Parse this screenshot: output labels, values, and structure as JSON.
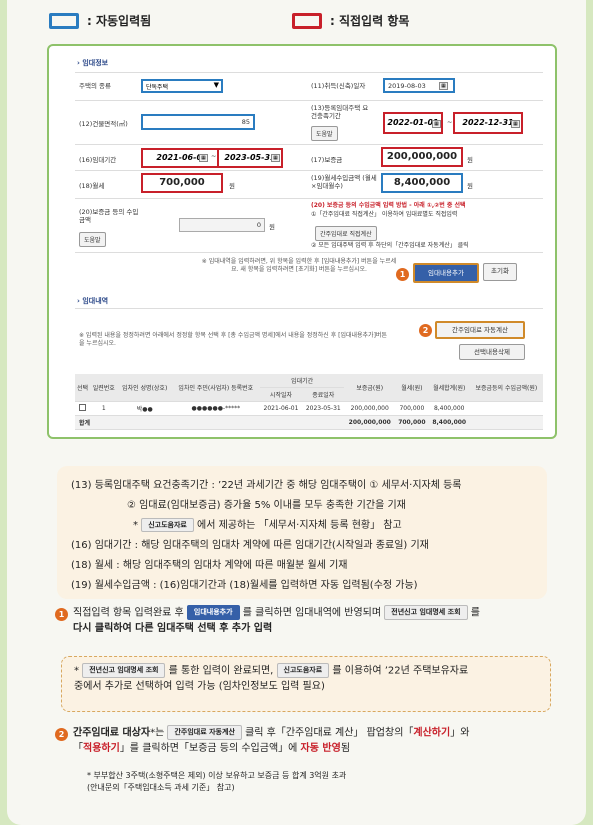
{
  "legend": {
    "auto_label": ": 자동입력됨",
    "manual_label": ": 직접입력 항목"
  },
  "lease_info": {
    "title": "› 임대정보",
    "house_type_label": "주택의 종류",
    "house_type_value": "단독주택",
    "acq_date_label": "(11)취득(신축)일자",
    "acq_date_value": "2019-08-03",
    "area_label": "(12)건물면적(㎡)",
    "area_value": "85",
    "req_period_label": "(13)등록임대주택 요건충족기간",
    "help_btn": "도움말",
    "req_start": "2022-01-01",
    "req_end": "2022-12-31",
    "lease_period_label": "(16)임대기간",
    "lease_start": "2021-06-01",
    "lease_end": "2023-05-31",
    "deposit_label": "(17)보증금",
    "deposit_value": "200,000,000",
    "unit_won": "원",
    "rent_label": "(18)월세",
    "rent_value": "700,000",
    "rent_income_label": "(19)월세수입금액 (월세×임대월수)",
    "rent_income_value": "8,400,000",
    "dep_income_label": "(20)보증금 등의 수입금액",
    "dep_income_value": "0",
    "note_line1": "(20) 보증금 등의 수입금액 입력 방법 - 아래 ①,②번 중 선택",
    "note_line2": "①「간주임대료 직접계산」 이용하여 임대료별도 직접입력",
    "note_btn": "간주임대료 직접계산",
    "note_line3": "② 모든 임대주택 입력 후 하단의「간주임대료 자동계산」 클릭",
    "hint": "※ 임대내역을 입력하려면, 위 항목을 입력한 후 [임대내용추가] 버튼을 누르세요. 새 항목을 입력하려면 [초기화] 버튼을 누르십시오.",
    "add_btn": "임대내용추가",
    "reset_btn": "초기화"
  },
  "lease_detail": {
    "title": "› 임대내역",
    "hint": "※ 입력된 내용을 정정하려면 아래에서 정정할 항목 선택 후 [총 수입금액 명세]에서 내용을 정정하신 후 [임대내용추가]버튼을 누르십시오.",
    "auto_btn": "간주임대료 자동계산",
    "delete_btn": "선택내용삭제",
    "headers": [
      "선택",
      "일련번호",
      "임차인 성명(상호)",
      "임차인 주민(사업자) 등록번호",
      "임대기간",
      "보증금(원)",
      "월세(원)",
      "월세합계(원)",
      "보증금등의 수입금액(원)"
    ],
    "sub_headers": [
      "시작일자",
      "종료일자"
    ],
    "row": [
      "1",
      "박●●",
      "●●●●●●-*****",
      "2021-06-01",
      "2023-05-31",
      "200,000,000",
      "700,000",
      "8,400,000",
      ""
    ],
    "total_label": "합계",
    "total": [
      "200,000,000",
      "700,000",
      "8,400,000",
      ""
    ]
  },
  "desc": {
    "l1": "(13) 등록임대주택 요건충족기간 : ’22년 과세기간 중 해당 임대주택이 ① 세무서·지자체 등록",
    "l2": "② 임대료(임대보증금) 증가율 5% 이내를 모두 충족한 기간을 기재",
    "l3_pre": "* ",
    "l3_chip": "신고도움자료",
    "l3_post": " 에서 제공하는 「세무서·지자체 등록 현황」 참고",
    "l4": "(16) 임대기간 : 해당 임대주택의 임대차 계약에 따른 임대기간(시작일과 종료일) 기재",
    "l5": "(18) 월세 : 해당 임대주택의 임대차 계약에 따른 매월분 월세 기재",
    "l6": "(19) 월세수입금액 : (16)임대기간과 (18)월세를 입력하면 자동 입력됨(수정 가능)"
  },
  "step1": {
    "pre": "직접입력 항목 입력완료 후 ",
    "chip1": "임대내용추가",
    "mid": " 를 클릭하면 임대내역에 반영되며 ",
    "chip2": "전년신고 임대명세 조회",
    "post": " 를",
    "line2": "다시 클릭하여 다른 임대주택 선택 후 추가 입력"
  },
  "note": {
    "pre": "* ",
    "chip1": "전년신고 임대명세 조회",
    "mid": " 를 통한 입력이 완료되면, ",
    "chip2": "신고도움자료",
    "post": " 를 이용하여 ’22년 주택보유자료",
    "line2": "중에서 추가로 선택하여 입력 가능 (임차인정보도 입력 필요)"
  },
  "step2": {
    "l1_a": "간주임대료 대상자",
    "l1_b": "*는 ",
    "chip": "간주임대료 자동계산",
    "l1_c": " 클릭 후「간주임대료 계산」 팝업창의「",
    "l1_d": "계산하기",
    "l1_e": "」와",
    "l2_a": "「",
    "l2_b": "적용하기",
    "l2_c": "」를 클릭하면「보증금 등의 수입금액」에 ",
    "l2_d": "자동 반영",
    "l2_e": "됨",
    "f1": "* 부부합산 3주택(소형주택은 제외) 이상 보유하고 보증금 등 합계 3억원 초과",
    "f2": "(안내문의「주택임대소득 과세 기준」 참고)"
  },
  "colors": {
    "auto_border": "#2a7cc0",
    "manual_border": "#c8202a",
    "badge": "#e06a20",
    "panel_border": "#8ec26a"
  }
}
